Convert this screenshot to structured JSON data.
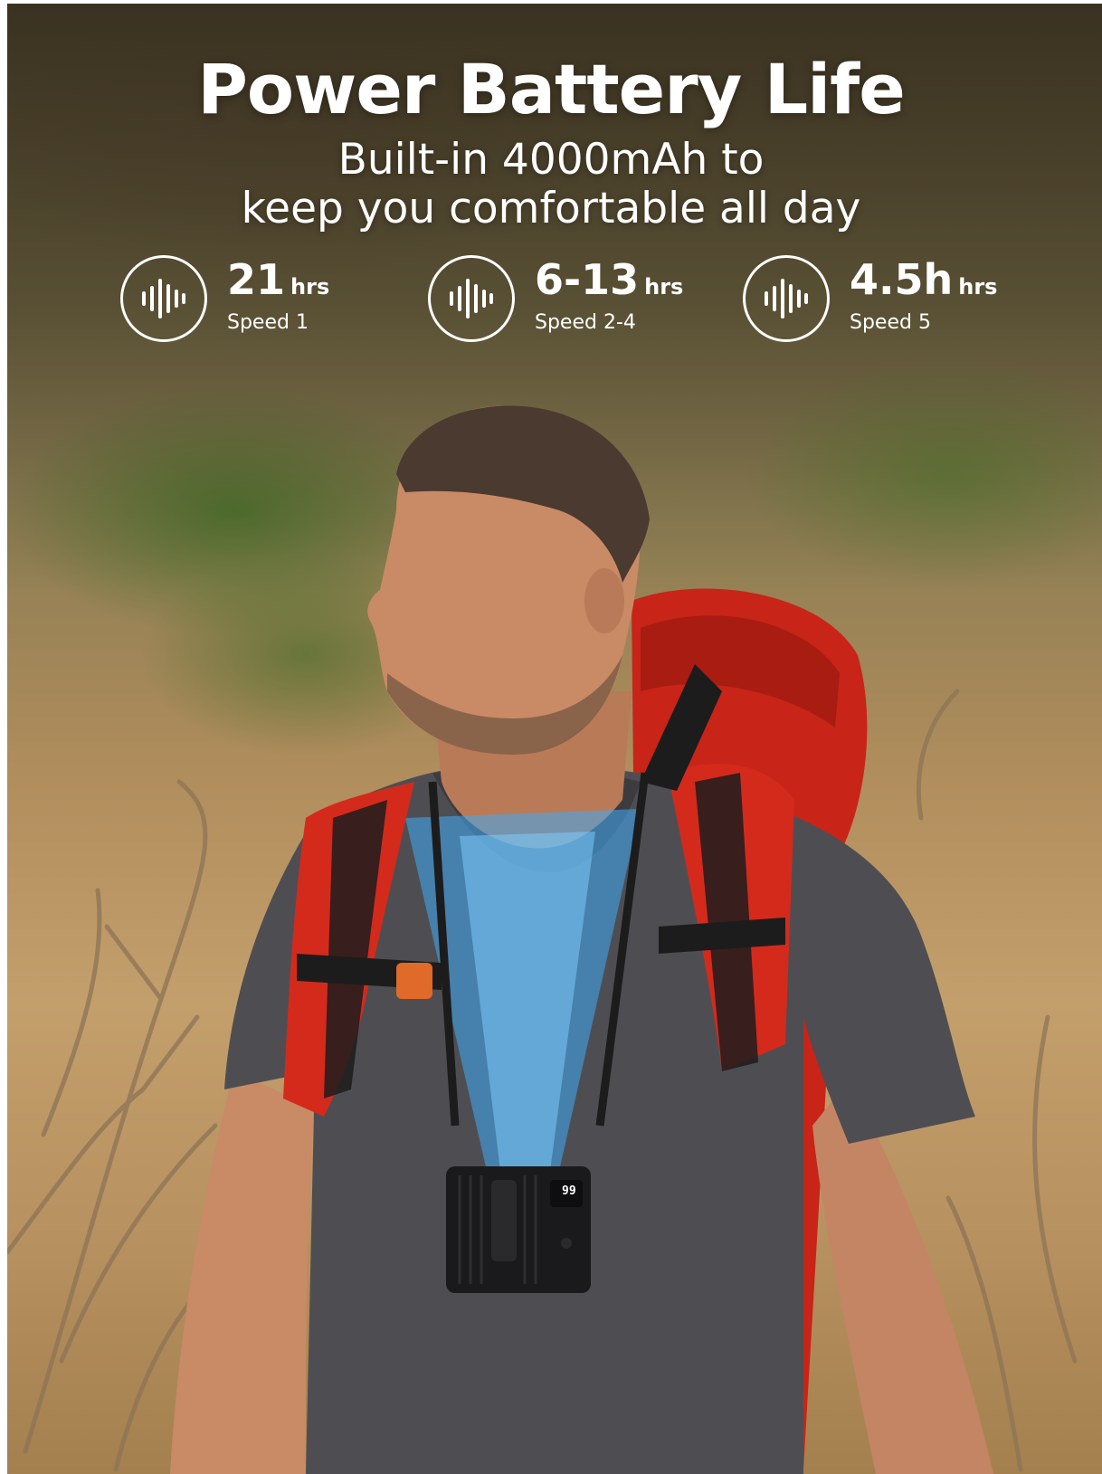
{
  "header": {
    "title": "Power Battery Life",
    "subtitle_line1": "Built-in 4000mAh to",
    "subtitle_line2": "keep you comfortable all day"
  },
  "stats": [
    {
      "value": "21",
      "unit": "hrs",
      "label": "Speed 1",
      "icon": "sound-wave-icon"
    },
    {
      "value": "6-13",
      "unit": "hrs",
      "label": "Speed 2-4",
      "icon": "sound-wave-icon"
    },
    {
      "value": "4.5h",
      "unit": "hrs",
      "label": "Speed 5",
      "icon": "sound-wave-icon"
    }
  ],
  "device": {
    "display_text": "99"
  },
  "colors": {
    "backpack_red": "#d42a1c",
    "airflow_blue": "#3fa9f5",
    "text": "#ffffff"
  }
}
